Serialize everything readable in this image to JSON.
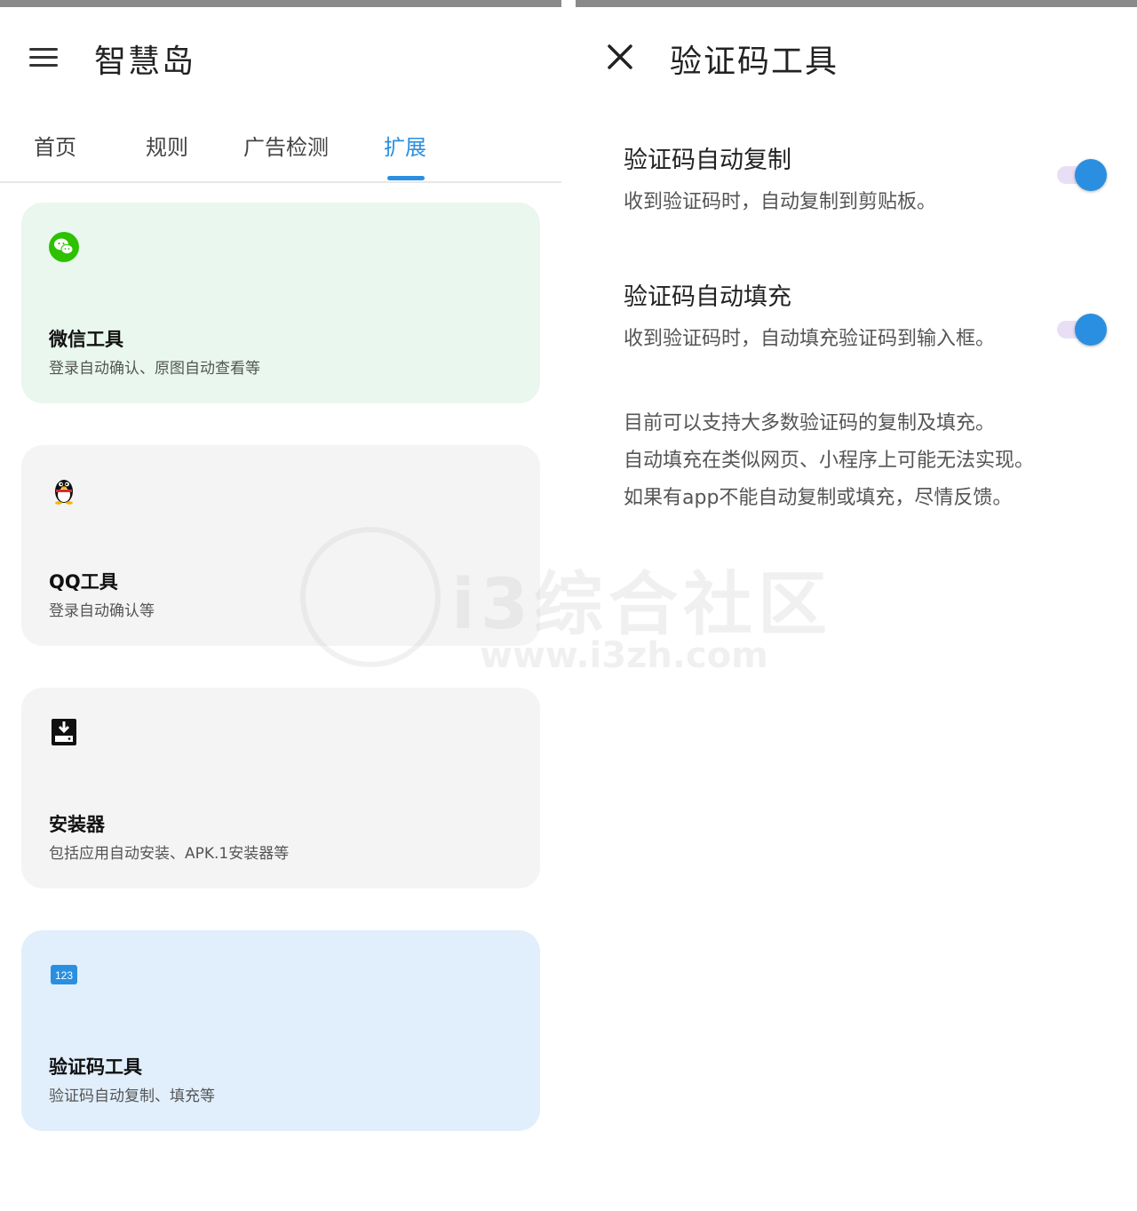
{
  "left": {
    "app_title": "智慧岛",
    "menu_icon": "menu-icon",
    "tabs": [
      {
        "label": "首页",
        "active": false
      },
      {
        "label": "规则",
        "active": false
      },
      {
        "label": "广告检测",
        "active": false
      },
      {
        "label": "扩展",
        "active": true
      }
    ],
    "cards": [
      {
        "icon": "wechat-icon",
        "title": "微信工具",
        "subtitle": "登录自动确认、原图自动查看等",
        "bg": "#e9f7ee"
      },
      {
        "icon": "qq-penguin-icon",
        "title": "QQ工具",
        "subtitle": "登录自动确认等",
        "bg": "#f4f4f4"
      },
      {
        "icon": "installer-icon",
        "title": "安装器",
        "subtitle": "包括应用自动安装、APK.1安装器等",
        "bg": "#f4f4f4"
      },
      {
        "icon": "numeric-123-icon",
        "title": "验证码工具",
        "subtitle": "验证码自动复制、填充等",
        "bg": "#e1effc"
      }
    ]
  },
  "right": {
    "close_icon": "close-icon",
    "title": "验证码工具",
    "settings": [
      {
        "title": "验证码自动复制",
        "desc": "收到验证码时，自动复制到剪贴板。",
        "enabled": true
      },
      {
        "title": "验证码自动填充",
        "desc": "收到验证码时，自动填充验证码到输入框。",
        "enabled": true
      }
    ],
    "info_lines": [
      "目前可以支持大多数验证码的复制及填充。",
      "自动填充在类似网页、小程序上可能无法实现。",
      "如果有app不能自动复制或填充，尽情反馈。"
    ]
  },
  "watermark": {
    "text": "i3综合社区",
    "url": "www.i3zh.com"
  },
  "colors": {
    "accent": "#2a8fe0",
    "wechat": "#2dc100",
    "toggle_track": "#e8dff6"
  }
}
